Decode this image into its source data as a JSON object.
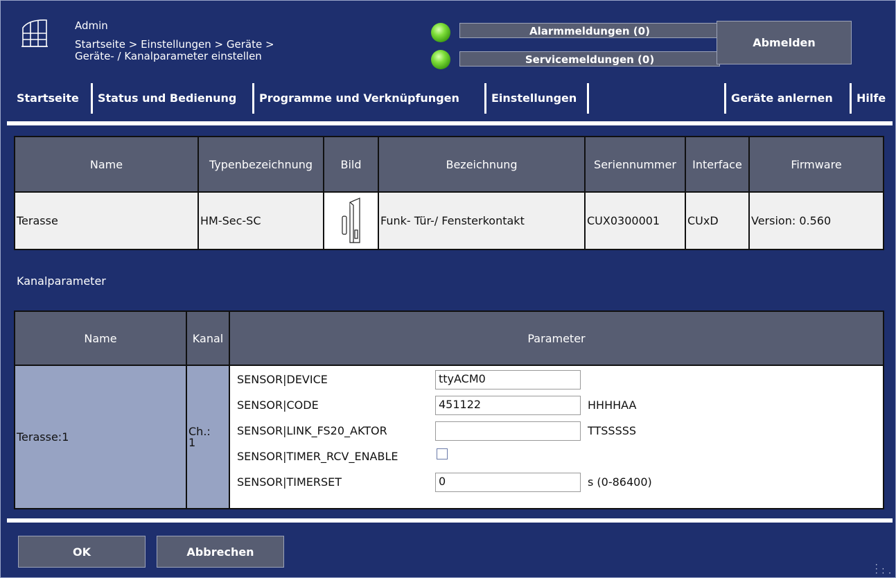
{
  "header": {
    "user": "Admin",
    "breadcrumb_line1": "Startseite > Einstellungen > Geräte >",
    "breadcrumb_line2": "Geräte- / Kanalparameter einstellen",
    "alarm_label": "Alarmmeldungen (0)",
    "service_label": "Servicemeldungen (0)",
    "logout_label": "Abmelden",
    "status_color": "#7ede3a"
  },
  "nav": {
    "home": "Startseite",
    "status": "Status und Bedienung",
    "programs": "Programme und Verknüpfungen",
    "settings": "Einstellungen",
    "teach": "Geräte anlernen",
    "help": "Hilfe"
  },
  "device_table": {
    "headers": [
      "Name",
      "Typenbezeichnung",
      "Bild",
      "Bezeichnung",
      "Seriennummer",
      "Interface",
      "Firmware"
    ],
    "row": {
      "name": "Terasse",
      "type": "HM-Sec-SC",
      "image_icon": "door-window-contact-icon",
      "description": "Funk- Tür-/ Fensterkontakt",
      "serial": "CUX0300001",
      "interface": "CUxD",
      "firmware": "Version: 0.560"
    }
  },
  "channel_section_title": "Kanalparameter",
  "channel_table": {
    "headers": [
      "Name",
      "Kanal",
      "Parameter"
    ],
    "row": {
      "name": "Terasse:1",
      "channel_prefix": "Ch.:",
      "channel_number": "1",
      "params": [
        {
          "label": "SENSOR|DEVICE",
          "value": "ttyACM0",
          "unit": ""
        },
        {
          "label": "SENSOR|CODE",
          "value": "451122",
          "unit": "HHHHAA"
        },
        {
          "label": "SENSOR|LINK_FS20_AKTOR",
          "value": "",
          "unit": "TTSSSSS"
        },
        {
          "label": "SENSOR|TIMER_RCV_ENABLE",
          "checked": false
        },
        {
          "label": "SENSOR|TIMERSET",
          "value": "0",
          "unit": "s (0-86400)"
        }
      ]
    }
  },
  "footer": {
    "ok_label": "OK",
    "cancel_label": "Abbrechen"
  }
}
